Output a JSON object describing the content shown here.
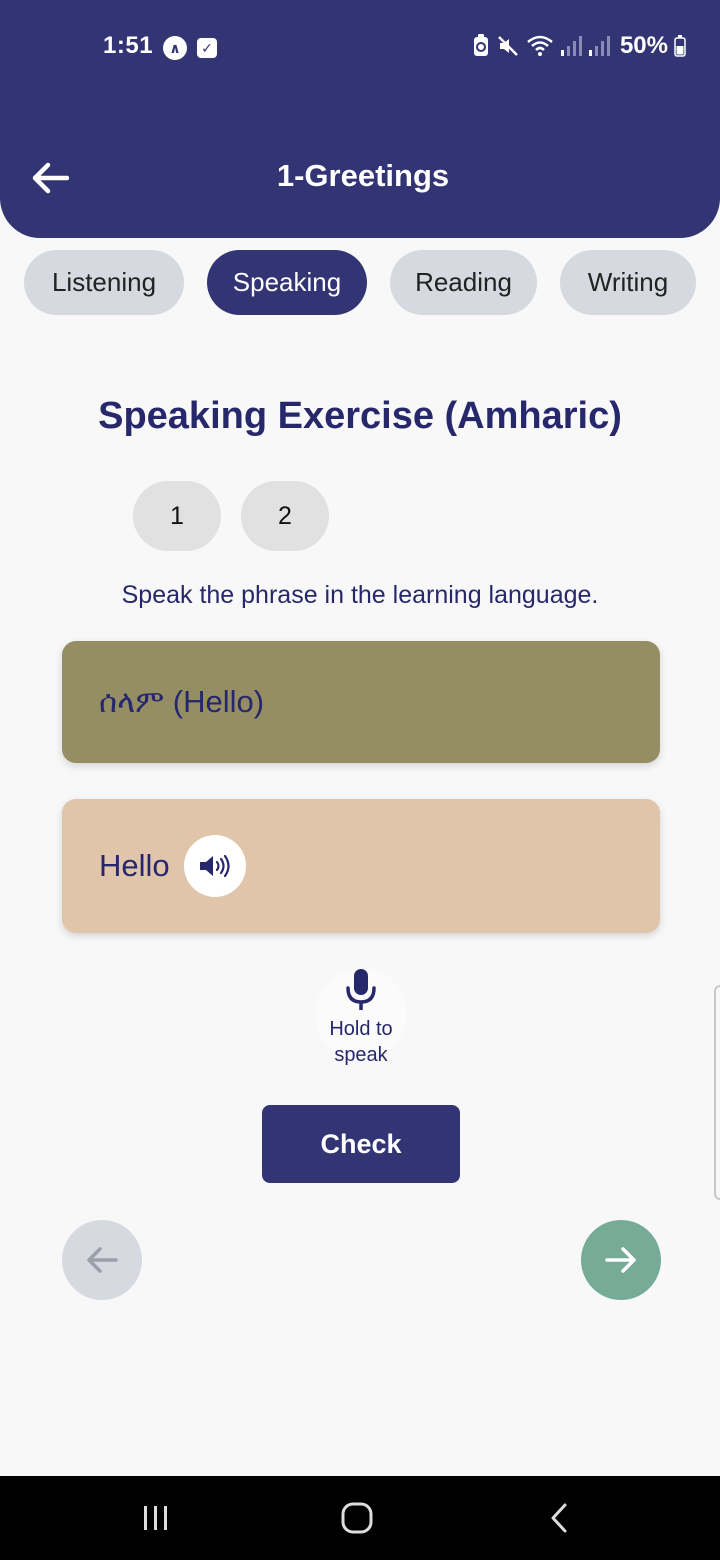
{
  "status_bar": {
    "time": "1:51",
    "left_icons": [
      "nav-arrow-icon",
      "check-square-icon"
    ],
    "right_icons": [
      "battery-saver-icon",
      "mute-icon",
      "wifi-icon",
      "signal-icon",
      "signal-icon"
    ],
    "battery": "50%"
  },
  "header": {
    "title": "1-Greetings",
    "back_icon": "arrow-left-icon"
  },
  "tabs": [
    {
      "label": "Listening",
      "active": false
    },
    {
      "label": "Speaking",
      "active": true
    },
    {
      "label": "Reading",
      "active": false
    },
    {
      "label": "Writing",
      "active": false
    }
  ],
  "exercise": {
    "title": "Speaking Exercise (Amharic)",
    "pages": [
      "1",
      "2"
    ],
    "instruction": "Speak the phrase in the learning language.",
    "phrase": "ሰላም (Hello)",
    "translation": "Hello",
    "speaker_icon": "speaker-icon",
    "mic_label_line1": "Hold to",
    "mic_label_line2": "speak",
    "check_label": "Check"
  },
  "navigation": {
    "prev_icon": "arrow-left-icon",
    "next_icon": "arrow-right-icon"
  },
  "colors": {
    "primary": "#323473",
    "phrase_card": "#958d63",
    "translation_card": "#e1c5ab",
    "next_button": "#75ab97",
    "inactive": "#d6d9df"
  }
}
